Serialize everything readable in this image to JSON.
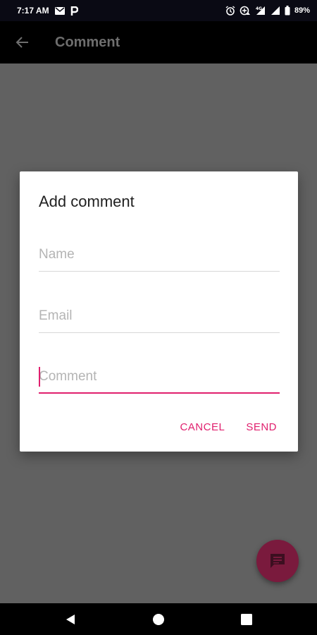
{
  "status_bar": {
    "time": "7:17 AM",
    "battery": "89%",
    "icons": [
      "mail-icon",
      "p-app-icon",
      "alarm-icon",
      "data-saver-icon",
      "signal-4g-icon",
      "signal-icon",
      "battery-icon"
    ]
  },
  "app_bar": {
    "title": "Comment",
    "back_icon": "arrow-left-icon"
  },
  "dialog": {
    "title": "Add comment",
    "fields": {
      "name": {
        "placeholder": "Name",
        "value": ""
      },
      "email": {
        "placeholder": "Email",
        "value": ""
      },
      "comment": {
        "placeholder": "Comment",
        "value": ""
      }
    },
    "cancel_label": "CANCEL",
    "send_label": "SEND"
  },
  "fab": {
    "icon": "comment-icon"
  },
  "nav_bar": {
    "icons": [
      "nav-back-icon",
      "nav-home-icon",
      "nav-recent-icon"
    ]
  },
  "colors": {
    "accent": "#e0206e",
    "fab": "#7a1a3d",
    "scrim": "#616161"
  }
}
